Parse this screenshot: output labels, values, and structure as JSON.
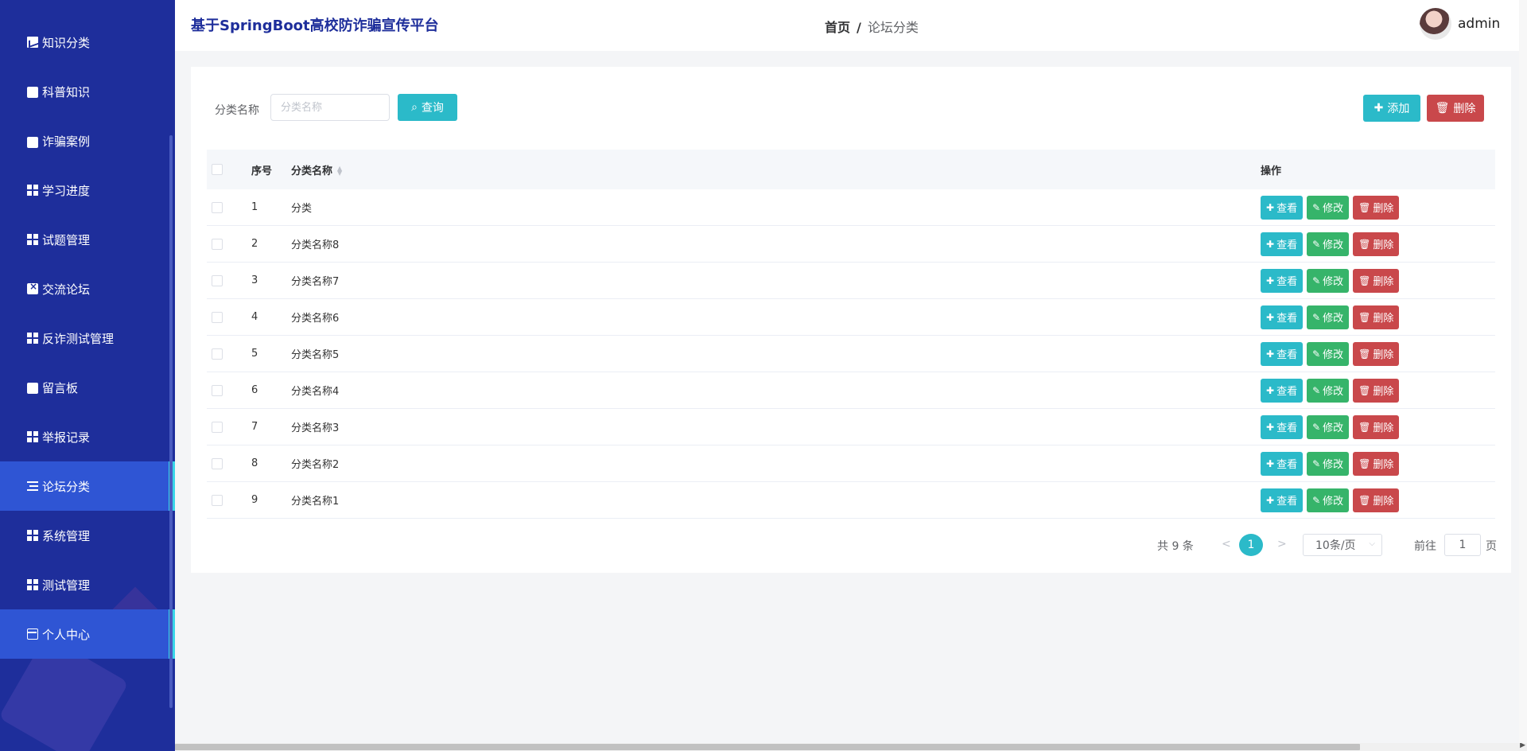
{
  "app": {
    "title": "基于SpringBoot高校防诈骗宣传平台"
  },
  "sidebar": {
    "items": [
      {
        "label": "知识分类",
        "icon": "chart-icon"
      },
      {
        "label": "科普知识",
        "icon": "ticket-icon"
      },
      {
        "label": "诈骗案例",
        "icon": "case-icon"
      },
      {
        "label": "学习进度",
        "icon": "grid-icon"
      },
      {
        "label": "试题管理",
        "icon": "grid-icon"
      },
      {
        "label": "交流论坛",
        "icon": "clipboard-icon"
      },
      {
        "label": "反诈测试管理",
        "icon": "grid-icon"
      },
      {
        "label": "留言板",
        "icon": "chat-icon"
      },
      {
        "label": "举报记录",
        "icon": "grid-icon"
      },
      {
        "label": "论坛分类",
        "icon": "list-icon",
        "active": true
      },
      {
        "label": "系统管理",
        "icon": "grid-icon"
      },
      {
        "label": "测试管理",
        "icon": "grid-icon"
      },
      {
        "label": "个人中心",
        "icon": "card-icon",
        "hover": true
      }
    ]
  },
  "header": {
    "breadcrumb_home": "首页",
    "breadcrumb_sep": "/",
    "breadcrumb_current": "论坛分类",
    "username": "admin"
  },
  "search": {
    "label": "分类名称",
    "placeholder": "分类名称",
    "query_label": "查询",
    "add_label": "添加",
    "delete_label": "删除"
  },
  "table": {
    "headers": {
      "index": "序号",
      "name": "分类名称",
      "ops": "操作"
    },
    "ops": {
      "view": "查看",
      "edit": "修改",
      "delete": "删除"
    },
    "rows": [
      {
        "index": "1",
        "name": "分类"
      },
      {
        "index": "2",
        "name": "分类名称8"
      },
      {
        "index": "3",
        "name": "分类名称7"
      },
      {
        "index": "4",
        "name": "分类名称6"
      },
      {
        "index": "5",
        "name": "分类名称5"
      },
      {
        "index": "6",
        "name": "分类名称4"
      },
      {
        "index": "7",
        "name": "分类名称3"
      },
      {
        "index": "8",
        "name": "分类名称2"
      },
      {
        "index": "9",
        "name": "分类名称1"
      }
    ]
  },
  "pagination": {
    "total": "共 9 条",
    "prev": "<",
    "current": "1",
    "next": ">",
    "page_size": "10条/页",
    "goto": "前往",
    "page_value": "1",
    "page_unit": "页"
  },
  "colors": {
    "sidebar": "#1e2e9b",
    "active": "#2f55d4",
    "accent": "#2bbac9",
    "edit": "#36b46a",
    "danger": "#c9484b"
  }
}
